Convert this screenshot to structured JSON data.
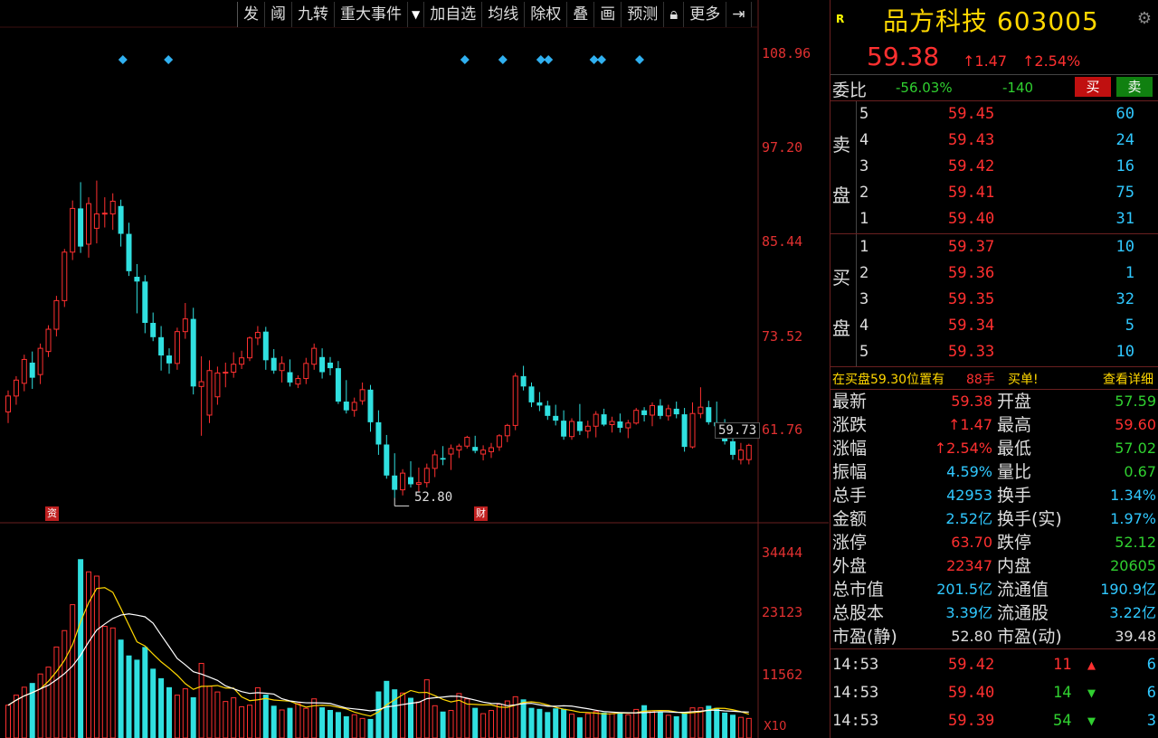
{
  "toolbar": [
    "发",
    "阈",
    "九转",
    "重大事件",
    "加自选",
    "均线",
    "除权",
    "叠",
    "画",
    "预测",
    "更多"
  ],
  "axis": {
    "price_ticks": [
      "108.96",
      "97.20",
      "85.44",
      "73.52",
      "61.76"
    ],
    "volume_ticks": [
      "34444",
      "23123",
      "11562"
    ],
    "volume_unit": "X10"
  },
  "chart_marks": {
    "low_label": "52.80",
    "last_tag": "59.73",
    "badge_left": "资",
    "badge_mid": "财"
  },
  "stock": {
    "flag": "R",
    "name": "品方科技 603005",
    "price": "59.38",
    "change": "↑1.47",
    "pct": "↑2.54%"
  },
  "weibi": {
    "label": "委比",
    "ratio": "-56.03%",
    "diff": "-140",
    "buy": "买",
    "sell": "卖"
  },
  "sell_book": {
    "side_top": "卖",
    "side_bottom": "盘",
    "levels": [
      {
        "n": "5",
        "price": "59.45",
        "qty": "60"
      },
      {
        "n": "4",
        "price": "59.43",
        "qty": "24"
      },
      {
        "n": "3",
        "price": "59.42",
        "qty": "16"
      },
      {
        "n": "2",
        "price": "59.41",
        "qty": "75"
      },
      {
        "n": "1",
        "price": "59.40",
        "qty": "31"
      }
    ]
  },
  "buy_book": {
    "side_top": "买",
    "side_bottom": "盘",
    "levels": [
      {
        "n": "1",
        "price": "59.37",
        "qty": "10"
      },
      {
        "n": "2",
        "price": "59.36",
        "qty": "1"
      },
      {
        "n": "3",
        "price": "59.35",
        "qty": "32"
      },
      {
        "n": "4",
        "price": "59.34",
        "qty": "5"
      },
      {
        "n": "5",
        "price": "59.33",
        "qty": "10"
      }
    ]
  },
  "bid_notice": {
    "text": "在买盘59.30位置有",
    "lots": "88手",
    "tag": "买单!",
    "link": "查看详细"
  },
  "stats": [
    {
      "k1": "最新",
      "v1": "59.38",
      "c1": "red",
      "k2": "开盘",
      "v2": "57.59",
      "c2": "green"
    },
    {
      "k1": "涨跌",
      "v1": "↑1.47",
      "c1": "red",
      "k2": "最高",
      "v2": "59.60",
      "c2": "red"
    },
    {
      "k1": "涨幅",
      "v1": "↑2.54%",
      "c1": "red",
      "k2": "最低",
      "v2": "57.02",
      "c2": "green"
    },
    {
      "k1": "振幅",
      "v1": "4.59%",
      "c1": "cyan",
      "k2": "量比",
      "v2": "0.67",
      "c2": "green"
    },
    {
      "k1": "总手",
      "v1": "42953",
      "c1": "cyan",
      "k2": "换手",
      "v2": "1.34%",
      "c2": "cyan"
    },
    {
      "k1": "金额",
      "v1": "2.52亿",
      "c1": "cyan",
      "k2": "换手(实)",
      "v2": "1.97%",
      "c2": "cyan"
    },
    {
      "k1": "涨停",
      "v1": "63.70",
      "c1": "red",
      "k2": "跌停",
      "v2": "52.12",
      "c2": "green"
    },
    {
      "k1": "外盘",
      "v1": "22347",
      "c1": "red",
      "k2": "内盘",
      "v2": "20605",
      "c2": "green"
    },
    {
      "k1": "总市值",
      "v1": "201.5亿",
      "c1": "cyan",
      "k2": "流通值",
      "v2": "190.9亿",
      "c2": "cyan"
    },
    {
      "k1": "总股本",
      "v1": "3.39亿",
      "c1": "cyan",
      "k2": "流通股",
      "v2": "3.22亿",
      "c2": "cyan"
    },
    {
      "k1": "市盈(静)",
      "v1": "52.80",
      "c1": "white",
      "k2": "市盈(动)",
      "v2": "39.48",
      "c2": "white"
    }
  ],
  "ticks": [
    {
      "time": "14:53",
      "price": "59.42",
      "vol": "11",
      "dir": "up",
      "n": "6"
    },
    {
      "time": "14:53",
      "price": "59.40",
      "vol": "14",
      "dir": "down",
      "n": "6"
    },
    {
      "time": "14:53",
      "price": "59.39",
      "vol": "54",
      "dir": "down",
      "n": "3"
    }
  ],
  "chart_data": {
    "type": "candlestick",
    "y_range": [
      50.0,
      112.0
    ],
    "volume_range": [
      0,
      40000
    ],
    "candles": [
      [
        63.6,
        66.3,
        62.2,
        65.6
      ],
      [
        65.6,
        68.1,
        64.5,
        67.6
      ],
      [
        67.2,
        70.8,
        66.2,
        70.2
      ],
      [
        69.8,
        71.2,
        66.5,
        67.9
      ],
      [
        68.3,
        72.2,
        67.1,
        71.6
      ],
      [
        71.2,
        74.5,
        70.5,
        74.0
      ],
      [
        74.0,
        78.2,
        73.1,
        77.6
      ],
      [
        77.6,
        84.1,
        76.8,
        83.7
      ],
      [
        83.7,
        90.2,
        82.7,
        89.2
      ],
      [
        89.2,
        92.5,
        83.6,
        84.4
      ],
      [
        84.7,
        90.6,
        83.0,
        89.8
      ],
      [
        86.7,
        92.7,
        84.8,
        88.5
      ],
      [
        88.5,
        90.6,
        86.8,
        88.6
      ],
      [
        88.5,
        91.1,
        86.5,
        90.1
      ],
      [
        89.5,
        90.3,
        84.4,
        86.0
      ],
      [
        86.0,
        87.4,
        80.7,
        81.3
      ],
      [
        80.6,
        82.2,
        76.0,
        80.0
      ],
      [
        80.0,
        80.8,
        73.5,
        74.8
      ],
      [
        74.8,
        76.1,
        72.5,
        73.0
      ],
      [
        73.0,
        74.4,
        68.8,
        70.7
      ],
      [
        70.7,
        71.6,
        68.4,
        69.7
      ],
      [
        69.7,
        74.2,
        68.9,
        73.7
      ],
      [
        73.7,
        77.3,
        72.8,
        75.3
      ],
      [
        75.3,
        76.7,
        65.8,
        66.8
      ],
      [
        66.8,
        70.6,
        60.6,
        67.4
      ],
      [
        63.2,
        70.1,
        62.2,
        68.8
      ],
      [
        65.5,
        69.3,
        64.5,
        68.5
      ],
      [
        68.5,
        69.8,
        66.7,
        68.6
      ],
      [
        68.6,
        71.1,
        67.9,
        69.6
      ],
      [
        69.6,
        71.3,
        69.0,
        70.4
      ],
      [
        70.4,
        73.1,
        70.0,
        72.9
      ],
      [
        72.9,
        74.4,
        72.0,
        73.6
      ],
      [
        73.7,
        74.3,
        68.9,
        70.1
      ],
      [
        70.4,
        71.5,
        68.4,
        68.8
      ],
      [
        68.8,
        70.6,
        67.3,
        69.7
      ],
      [
        68.6,
        70.2,
        66.8,
        67.3
      ],
      [
        67.1,
        68.2,
        66.6,
        67.8
      ],
      [
        67.8,
        70.4,
        67.1,
        69.7
      ],
      [
        69.6,
        72.2,
        68.9,
        71.6
      ],
      [
        70.5,
        71.6,
        67.8,
        68.6
      ],
      [
        69.8,
        70.5,
        68.2,
        69.1
      ],
      [
        69.1,
        70.0,
        64.6,
        64.9
      ],
      [
        64.9,
        67.6,
        63.4,
        63.8
      ],
      [
        63.8,
        65.4,
        63.0,
        64.8
      ],
      [
        65.0,
        67.3,
        64.5,
        66.4
      ],
      [
        66.4,
        67.0,
        61.1,
        62.3
      ],
      [
        62.3,
        63.8,
        58.2,
        59.5
      ],
      [
        59.5,
        60.7,
        55.2,
        55.6
      ],
      [
        55.6,
        58.4,
        52.8,
        53.8
      ],
      [
        53.8,
        56.4,
        53.1,
        55.9
      ],
      [
        55.4,
        57.4,
        54.1,
        54.5
      ],
      [
        54.5,
        56.6,
        53.6,
        54.7
      ],
      [
        54.7,
        57.1,
        54.1,
        56.5
      ],
      [
        56.5,
        58.8,
        55.4,
        58.2
      ],
      [
        57.8,
        59.3,
        56.9,
        57.6
      ],
      [
        58.3,
        59.5,
        56.3,
        59.0
      ],
      [
        58.8,
        59.6,
        57.8,
        59.3
      ],
      [
        59.3,
        60.6,
        59.0,
        60.4
      ],
      [
        59.2,
        60.6,
        58.4,
        58.7
      ],
      [
        58.3,
        59.4,
        57.5,
        58.8
      ],
      [
        58.6,
        59.7,
        57.8,
        59.1
      ],
      [
        59.2,
        60.8,
        58.7,
        60.6
      ],
      [
        60.6,
        62.1,
        59.8,
        61.9
      ],
      [
        61.9,
        68.5,
        61.3,
        68.1
      ],
      [
        68.1,
        69.4,
        66.3,
        66.8
      ],
      [
        66.8,
        67.3,
        64.2,
        64.8
      ],
      [
        64.8,
        66.1,
        63.7,
        64.4
      ],
      [
        64.4,
        65.0,
        62.6,
        63.1
      ],
      [
        63.1,
        64.5,
        61.9,
        62.5
      ],
      [
        62.5,
        63.8,
        60.1,
        60.5
      ],
      [
        60.5,
        62.8,
        60.1,
        62.4
      ],
      [
        62.4,
        64.6,
        60.7,
        61.2
      ],
      [
        61.2,
        62.5,
        60.3,
        61.8
      ],
      [
        61.8,
        63.7,
        60.4,
        63.3
      ],
      [
        63.3,
        64.0,
        61.8,
        62.0
      ],
      [
        62.0,
        63.0,
        61.0,
        62.4
      ],
      [
        62.4,
        63.4,
        61.0,
        61.6
      ],
      [
        61.6,
        62.6,
        60.3,
        62.2
      ],
      [
        62.2,
        64.1,
        62.0,
        63.8
      ],
      [
        63.8,
        64.2,
        62.4,
        63.2
      ],
      [
        63.2,
        64.8,
        61.8,
        64.4
      ],
      [
        64.4,
        65.2,
        62.7,
        63.1
      ],
      [
        63.1,
        64.5,
        62.5,
        64.0
      ],
      [
        64.0,
        64.9,
        62.8,
        63.3
      ],
      [
        63.3,
        64.1,
        58.6,
        59.2
      ],
      [
        59.2,
        64.8,
        59.0,
        63.4
      ],
      [
        63.4,
        66.7,
        62.8,
        64.2
      ],
      [
        64.2,
        65.0,
        62.0,
        62.3
      ],
      [
        62.3,
        64.9,
        61.5,
        61.8
      ],
      [
        61.8,
        62.7,
        59.5,
        59.9
      ],
      [
        59.9,
        60.5,
        57.6,
        58.2
      ],
      [
        57.6,
        59.7,
        57.0,
        58.8
      ],
      [
        57.6,
        59.6,
        57.0,
        59.4
      ]
    ],
    "volumes": [
      6200,
      8100,
      9600,
      10400,
      12100,
      13400,
      17200,
      20300,
      25200,
      33800,
      31400,
      30600,
      21100,
      20800,
      18600,
      15600,
      14800,
      17200,
      13100,
      11300,
      9600,
      8100,
      9300,
      7700,
      14100,
      9800,
      8700,
      6900,
      7600,
      5900,
      6200,
      9500,
      8200,
      6100,
      5300,
      5700,
      6500,
      5600,
      7400,
      5800,
      5300,
      4900,
      4100,
      4400,
      3700,
      3600,
      8800,
      10800,
      9200,
      8500,
      7600,
      6800,
      11000,
      6100,
      5000,
      5200,
      8400,
      7400,
      5700,
      4600,
      5200,
      6400,
      7000,
      7800,
      7300,
      5700,
      5500,
      4900,
      5600,
      5500,
      4500,
      3900,
      4600,
      5000,
      4800,
      4600,
      4700,
      4400,
      5400,
      6200,
      5100,
      4900,
      4300,
      4100,
      4900,
      5700,
      5700,
      6100,
      5700,
      4800,
      4400,
      3900,
      3700
    ],
    "price_ma": [],
    "volume_ma5_color": "#ffd700",
    "volume_ma10_color": "#ffffff",
    "up_color": "#ff3030",
    "down_color": "#30e0e0",
    "event_diamond_indices": [
      7,
      13,
      52,
      57,
      62,
      63,
      69,
      70,
      75
    ]
  }
}
